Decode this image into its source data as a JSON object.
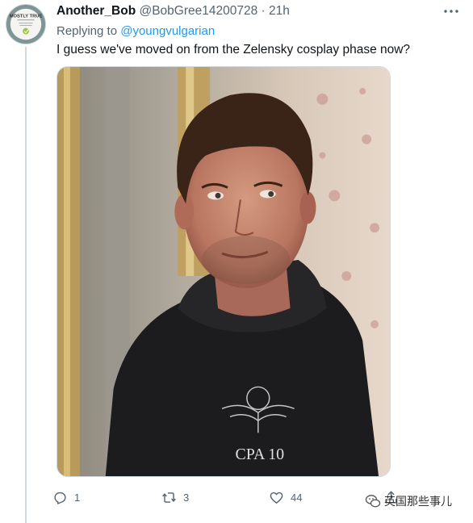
{
  "tweet": {
    "avatar": {
      "icon": "mostly-true-logo-icon",
      "logo_text": "MOSTLY TRUE"
    },
    "author": {
      "display_name": "Another_Bob",
      "handle": "@BobGree14200728",
      "separator": "·",
      "time": "21h"
    },
    "reply": {
      "prefix": "Replying to",
      "mention": "@youngvulgarian"
    },
    "text": "I guess we've moved on from the Zelensky cosplay phase now?",
    "media": {
      "hoodie_print": "CPA 10"
    },
    "actions": {
      "reply_count": "1",
      "retweet_count": "3",
      "like_count": "44",
      "share_icon": "share-icon"
    }
  },
  "watermark": {
    "text": "英国那些事儿",
    "icon": "wechat-icon"
  },
  "colors": {
    "link": "#1d9bf0",
    "secondary_text": "#536471",
    "thread_line": "#cfd9de"
  }
}
